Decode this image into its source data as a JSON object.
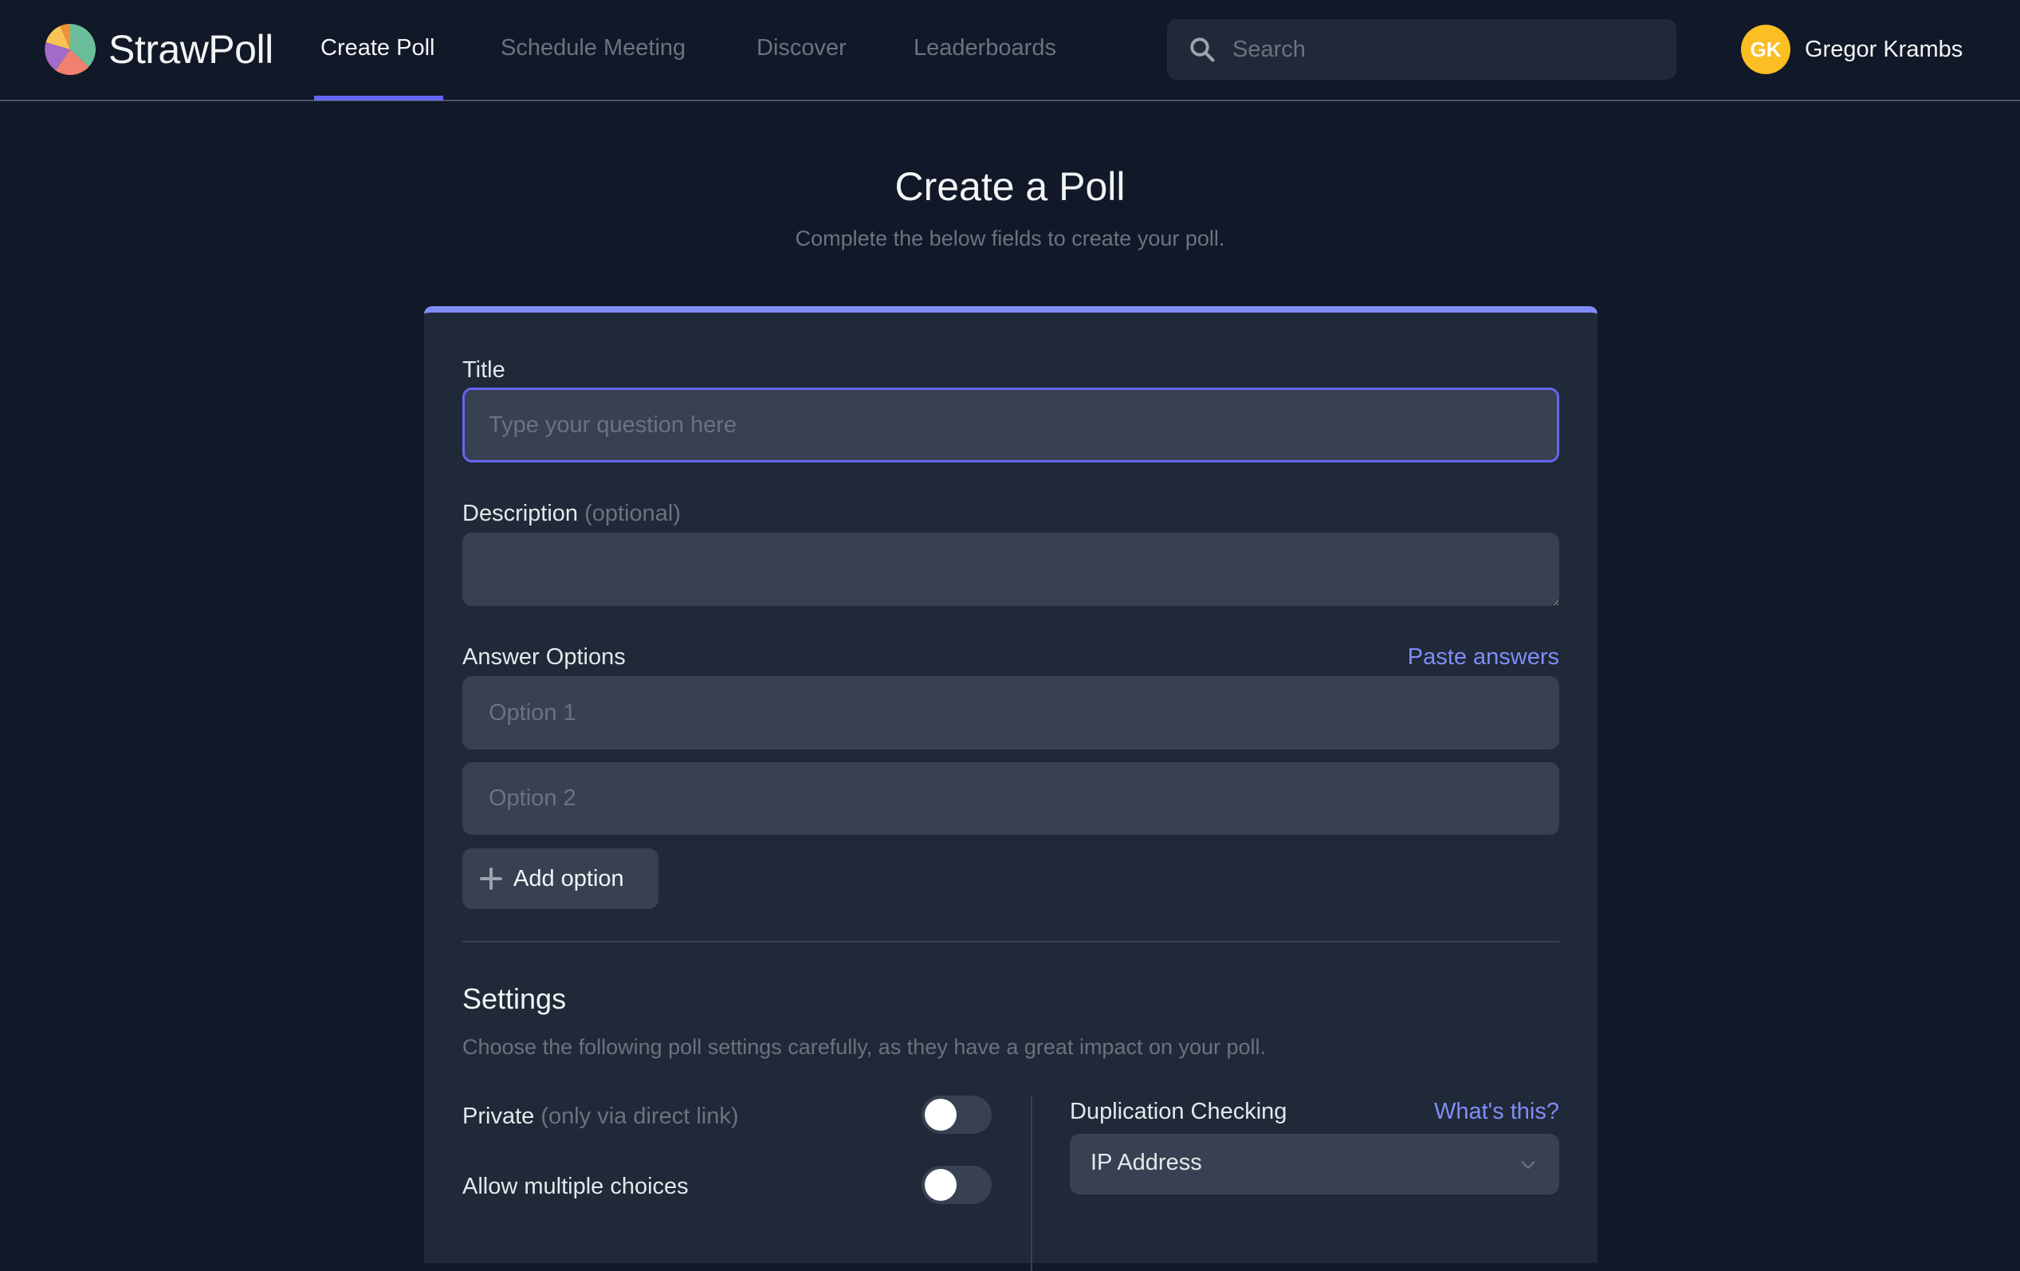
{
  "app": {
    "name": "StrawPoll",
    "logo_colors": [
      "#6abf9a",
      "#f08070",
      "#a36bc9",
      "#f7c453",
      "#f0913a"
    ]
  },
  "nav": {
    "items": [
      {
        "label": "Create Poll",
        "active": true
      },
      {
        "label": "Schedule Meeting",
        "active": false
      },
      {
        "label": "Discover",
        "active": false
      },
      {
        "label": "Leaderboards",
        "active": false
      }
    ]
  },
  "search": {
    "placeholder": "Search",
    "value": "",
    "icon": "search-icon"
  },
  "user": {
    "initials": "GK",
    "name": "Gregor Krambs",
    "avatar_color": "#fbbf24"
  },
  "page": {
    "title": "Create a Poll",
    "subtitle": "Complete the below fields to create your poll."
  },
  "form": {
    "title_label": "Title",
    "title_placeholder": "Type your question here",
    "title_value": "",
    "description_label": "Description",
    "description_optional": "(optional)",
    "description_value": "",
    "answers_label": "Answer Options",
    "paste_answers": "Paste answers",
    "options": [
      {
        "placeholder": "Option 1",
        "value": ""
      },
      {
        "placeholder": "Option 2",
        "value": ""
      }
    ],
    "add_option": "Add option"
  },
  "settings": {
    "title": "Settings",
    "description": "Choose the following poll settings carefully, as they have a great impact on your poll.",
    "private_label": "Private",
    "private_note": "(only via direct link)",
    "private_enabled": false,
    "multiple_label": "Allow multiple choices",
    "multiple_enabled": false,
    "duplication_label": "Duplication Checking",
    "whats_this": "What's this?",
    "duplication_value": "IP Address"
  },
  "colors": {
    "accent": "#6366f1",
    "accent_light": "#818cf8",
    "background": "#111827",
    "card": "#1f2937",
    "input": "#374151"
  }
}
